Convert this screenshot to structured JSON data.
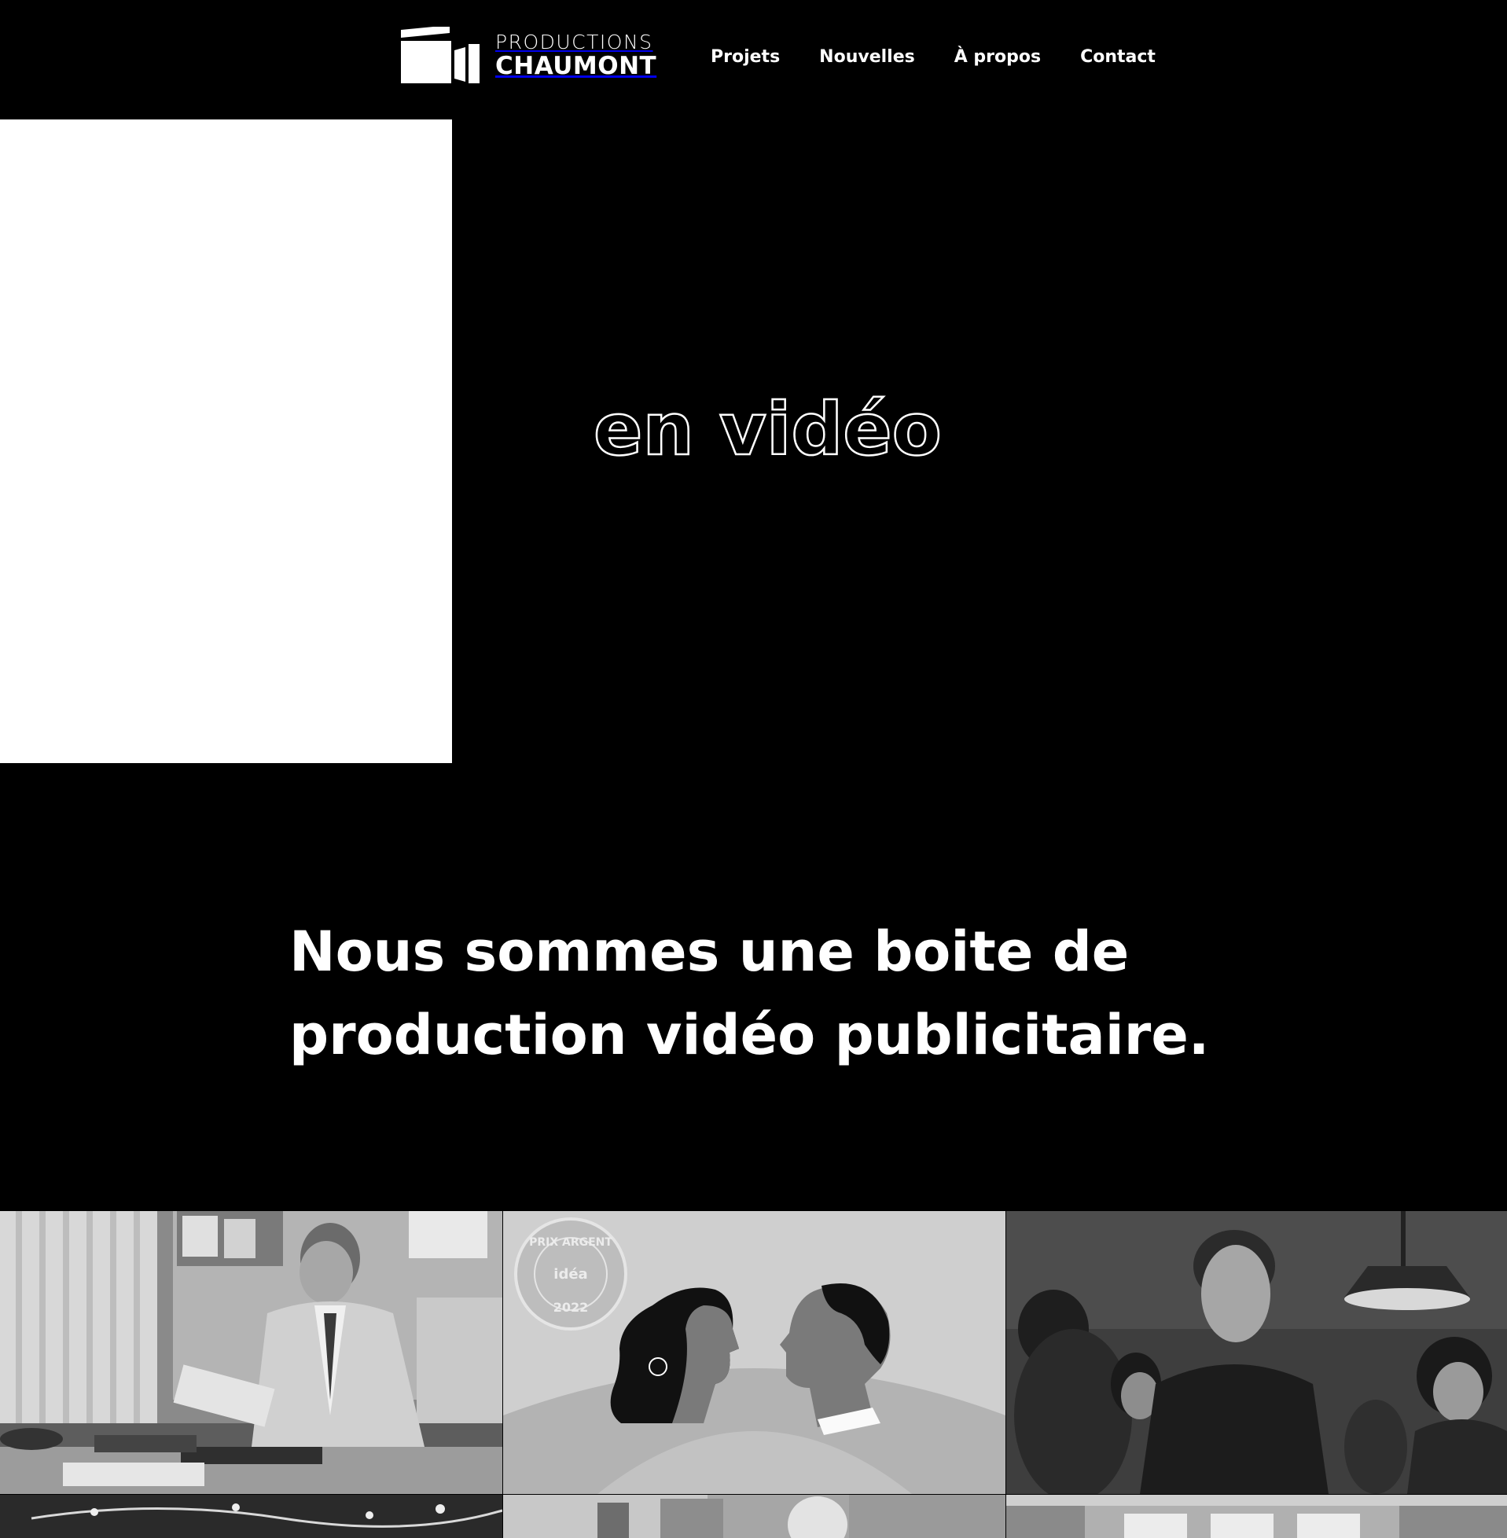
{
  "brand": {
    "line1": "PRODUCTIONS",
    "line2": "CHAUMONT"
  },
  "nav": {
    "items": [
      {
        "label": "Projets"
      },
      {
        "label": "Nouvelles"
      },
      {
        "label": "À propos"
      },
      {
        "label": "Contact"
      }
    ]
  },
  "hero": {
    "outline_text": "en vidéo"
  },
  "intro": {
    "line1": "Nous sommes une boite de",
    "line2": "production vidéo publicitaire."
  },
  "projects": {
    "tiles": [
      {
        "label": ""
      },
      {
        "label": "",
        "badge_top": "PRIX ARGENT",
        "badge_mid": "idéa",
        "badge_bottom": "2022"
      },
      {
        "label": ""
      },
      {
        "label": ""
      },
      {
        "label": ""
      },
      {
        "label": ""
      }
    ]
  }
}
